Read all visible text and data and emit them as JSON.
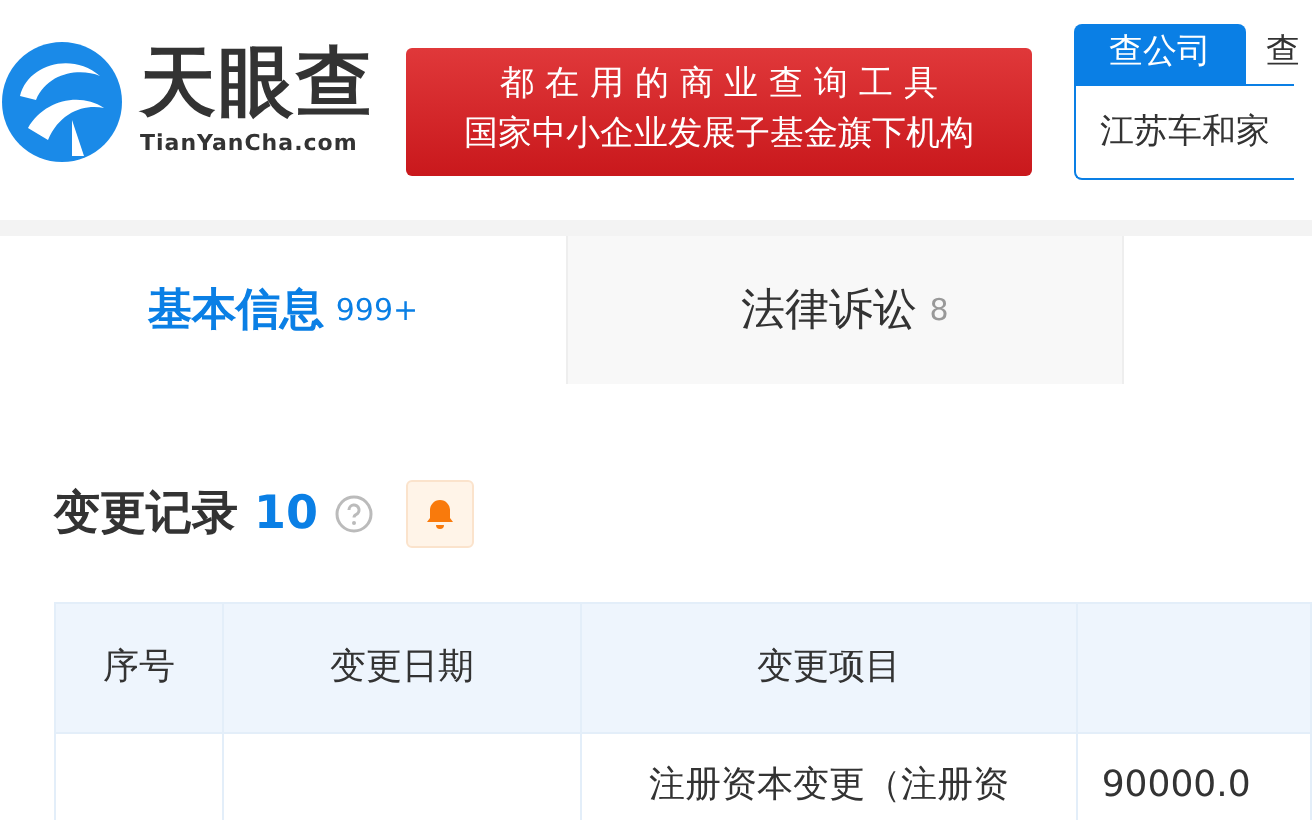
{
  "header": {
    "logo_text": "天眼查",
    "logo_domain": "TianYanCha.com",
    "banner_lines": [
      "都 在 用 的 商 业 查 询 工 具",
      "国家中小企业发展子基金旗下机构"
    ],
    "search": {
      "tabs": [
        {
          "label": "查公司",
          "selected": true
        },
        {
          "label": "查",
          "selected": false
        }
      ],
      "value": "江苏车和家"
    }
  },
  "tabs": [
    {
      "label": "基本信息",
      "count": "999+",
      "selected": true
    },
    {
      "label": "法律诉讼",
      "count": "8",
      "selected": false
    }
  ],
  "section": {
    "title": "变更记录",
    "count": "10"
  },
  "table": {
    "columns": [
      "序号",
      "变更日期",
      "变更项目"
    ],
    "rows": [
      [
        "",
        "",
        "注册资本变更（注册资",
        "90000.0"
      ]
    ]
  }
}
